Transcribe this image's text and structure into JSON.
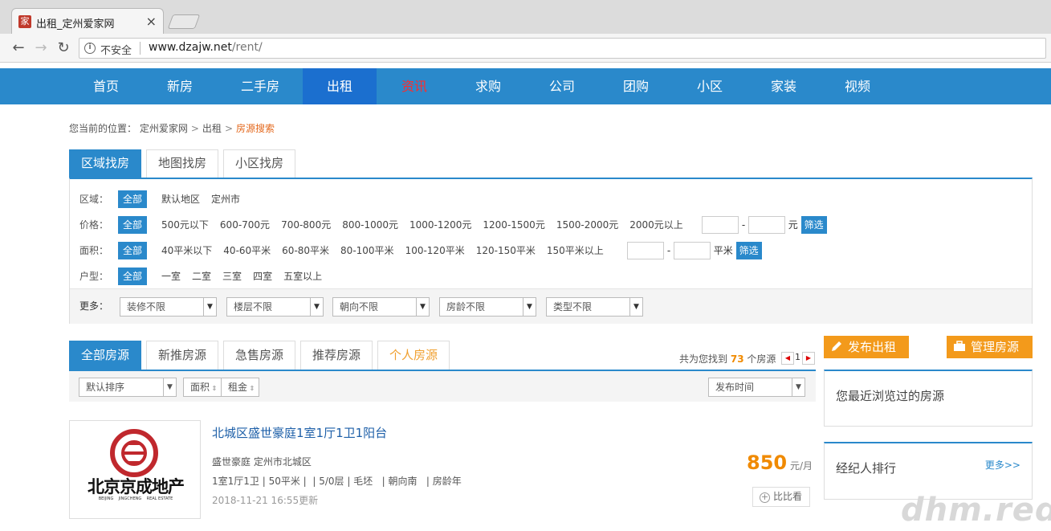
{
  "browser": {
    "tab_title": "出租_定州爱家网",
    "favicon_char": "家",
    "security_label": "不安全",
    "url_host": "www.dzajw.net",
    "url_path": "/rent/"
  },
  "nav": {
    "items": [
      "首页",
      "新房",
      "二手房",
      "出租",
      "资讯",
      "求购",
      "公司",
      "团购",
      "小区",
      "家装",
      "视频"
    ],
    "active": "出租",
    "highlight": "资讯"
  },
  "breadcrumb": {
    "prefix": "您当前的位置：",
    "crumbs": [
      "定州爱家网",
      "出租",
      "房源搜索"
    ]
  },
  "search_tabs": [
    "区域找房",
    "地图找房",
    "小区找房"
  ],
  "filters": {
    "area": {
      "label": "区域：",
      "all": "全部",
      "options": [
        "默认地区",
        "定州市"
      ]
    },
    "price": {
      "label": "价格：",
      "all": "全部",
      "options": [
        "500元以下",
        "600-700元",
        "700-800元",
        "800-1000元",
        "1000-1200元",
        "1200-1500元",
        "1500-2000元",
        "2000元以上"
      ],
      "unit": "元",
      "button": "筛选"
    },
    "size": {
      "label": "面积：",
      "all": "全部",
      "options": [
        "40平米以下",
        "40-60平米",
        "60-80平米",
        "80-100平米",
        "100-120平米",
        "120-150平米",
        "150平米以上"
      ],
      "unit": "平米",
      "button": "筛选"
    },
    "layout": {
      "label": "户型：",
      "all": "全部",
      "options": [
        "一室",
        "二室",
        "三室",
        "四室",
        "五室以上"
      ]
    },
    "more": {
      "label": "更多：",
      "selects": [
        "装修不限",
        "楼层不限",
        "朝向不限",
        "房龄不限",
        "类型不限"
      ]
    }
  },
  "result_tabs": [
    "全部房源",
    "新推房源",
    "急售房源",
    "推荐房源",
    "个人房源"
  ],
  "count": {
    "prefix": "共为您找到",
    "number": "73",
    "suffix": "个房源",
    "page": "1"
  },
  "sort": {
    "default": "默认排序",
    "area": "面积",
    "rent": "租金",
    "time": "发布时间"
  },
  "listing": {
    "title": "北城区盛世豪庭1室1厅1卫1阳台",
    "location": "盛世豪庭 定州市北城区",
    "specs": "1室1厅1卫 | 50平米 |  | 5/0层 | 毛坯   | 朝向南   | 房龄年",
    "updated": "2018-11-21 16:55更新",
    "price": "850",
    "price_unit": "元/月",
    "compare": "比比看",
    "logo_text": "北京京成地产",
    "logo_sub": "BEIJING    JINGCHENG    REAL ESTATE"
  },
  "sidebar": {
    "publish": "发布出租",
    "manage": "管理房源",
    "recent": "您最近浏览过的房源",
    "agents": "经纪人排行",
    "more": "更多>>"
  },
  "watermark": "dhm.red",
  "colors": {
    "primary": "#2a89cb",
    "accent": "#f39a1b",
    "price": "#f08a00"
  }
}
